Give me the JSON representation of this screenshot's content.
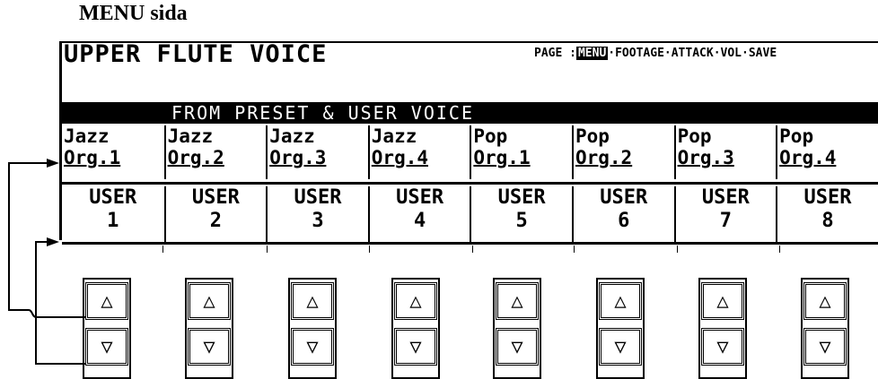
{
  "caption": "MENU sida",
  "screen": {
    "title": "UPPER FLUTE VOICE",
    "page_label": "PAGE :",
    "pages": [
      "MENU",
      "FOOTAGE",
      "ATTACK",
      "VOL",
      "SAVE"
    ],
    "selected_page": "MENU",
    "banner": "FROM PRESET & USER VOICE",
    "presets": [
      {
        "line1": "Jazz",
        "line2": "Org.1"
      },
      {
        "line1": "Jazz",
        "line2": "Org.2"
      },
      {
        "line1": "Jazz",
        "line2": "Org.3"
      },
      {
        "line1": "Jazz",
        "line2": "Org.4"
      },
      {
        "line1": "Pop",
        "line2": "Org.1"
      },
      {
        "line1": "Pop",
        "line2": "Org.2"
      },
      {
        "line1": "Pop",
        "line2": "Org.3"
      },
      {
        "line1": "Pop",
        "line2": "Org.4"
      }
    ],
    "users": [
      {
        "line1": "USER",
        "line2": "1"
      },
      {
        "line1": "USER",
        "line2": "2"
      },
      {
        "line1": "USER",
        "line2": "3"
      },
      {
        "line1": "USER",
        "line2": "4"
      },
      {
        "line1": "USER",
        "line2": "5"
      },
      {
        "line1": "USER",
        "line2": "6"
      },
      {
        "line1": "USER",
        "line2": "7"
      },
      {
        "line1": "USER",
        "line2": "8"
      }
    ]
  },
  "buttons": {
    "up_symbol": "△",
    "down_symbol": "▽"
  }
}
